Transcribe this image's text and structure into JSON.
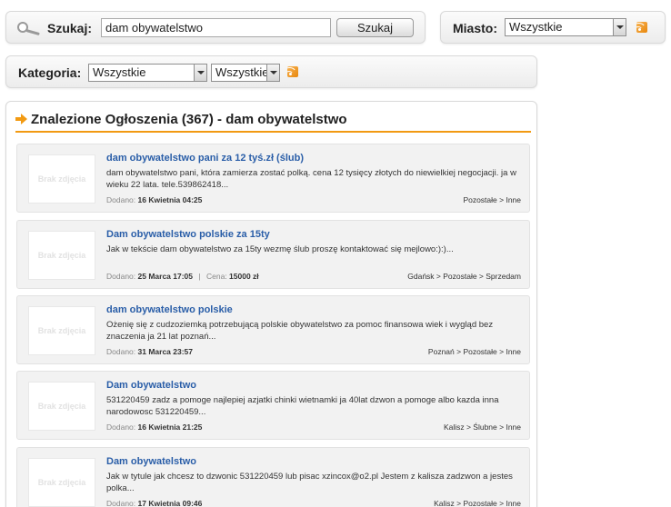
{
  "search": {
    "label": "Szukaj:",
    "value": "dam obywatelstwo",
    "button": "Szukaj"
  },
  "city": {
    "label": "Miasto:",
    "selected": "Wszystkie"
  },
  "category": {
    "label": "Kategoria:",
    "selected1": "Wszystkie",
    "selected2": "Wszystkie"
  },
  "results": {
    "title": "Znalezione Ogłoszenia (367) - dam obywatelstwo",
    "no_image_text": "Brak zdjęcia",
    "date_label": "Dodano:",
    "price_label": "Cena:",
    "listings": [
      {
        "title": "dam obywatelstwo pani za 12 tyś.zł (ślub)",
        "desc": "dam obywatelstwo pani, która zamierza zostać polką. cena 12 tysięcy złotych do niewielkiej negocjacji. ja w wieku 22 lata. tele.539862418...",
        "date": "16 Kwietnia 04:25",
        "price": "",
        "category": "Pozostałe > Inne"
      },
      {
        "title": "Dam obywatelstwo polskie za 15ty",
        "desc": "Jak w tekście dam obywatelstwo za 15ty wezmę ślub proszę kontaktować się mejlowo:):)...",
        "date": "25 Marca 17:05",
        "price": "15000 zł",
        "category": "Gdańsk > Pozostałe > Sprzedam"
      },
      {
        "title": "dam obywatelstwo polskie",
        "desc": "Ożenię się z cudzoziemką potrzebującą polskie obywatelstwo za pomoc finansowa wiek i wygląd bez znaczenia ja 21 lat poznań...",
        "date": "31 Marca 23:57",
        "price": "",
        "category": "Poznań > Pozostałe > Inne"
      },
      {
        "title": "Dam obywatelstwo",
        "desc": "531220459 zadz a pomoge najlepiej azjatki chinki wietnamki ja 40lat dzwon a pomoge albo kazda inna narodowosc 531220459...",
        "date": "16 Kwietnia 21:25",
        "price": "",
        "category": "Kalisz > Ślubne > Inne"
      },
      {
        "title": "Dam obywatelstwo",
        "desc": "Jak w tytule jak chcesz to dzwonic 531220459 lub pisac xzincox@o2.pl Jestem z kalisza zadzwon a jestes polka...",
        "date": "17 Kwietnia 09:46",
        "price": "",
        "category": "Kalisz > Pozostałe > Inne"
      }
    ]
  },
  "colors": {
    "accent": "#f29a12",
    "link": "#2a5ea8"
  }
}
